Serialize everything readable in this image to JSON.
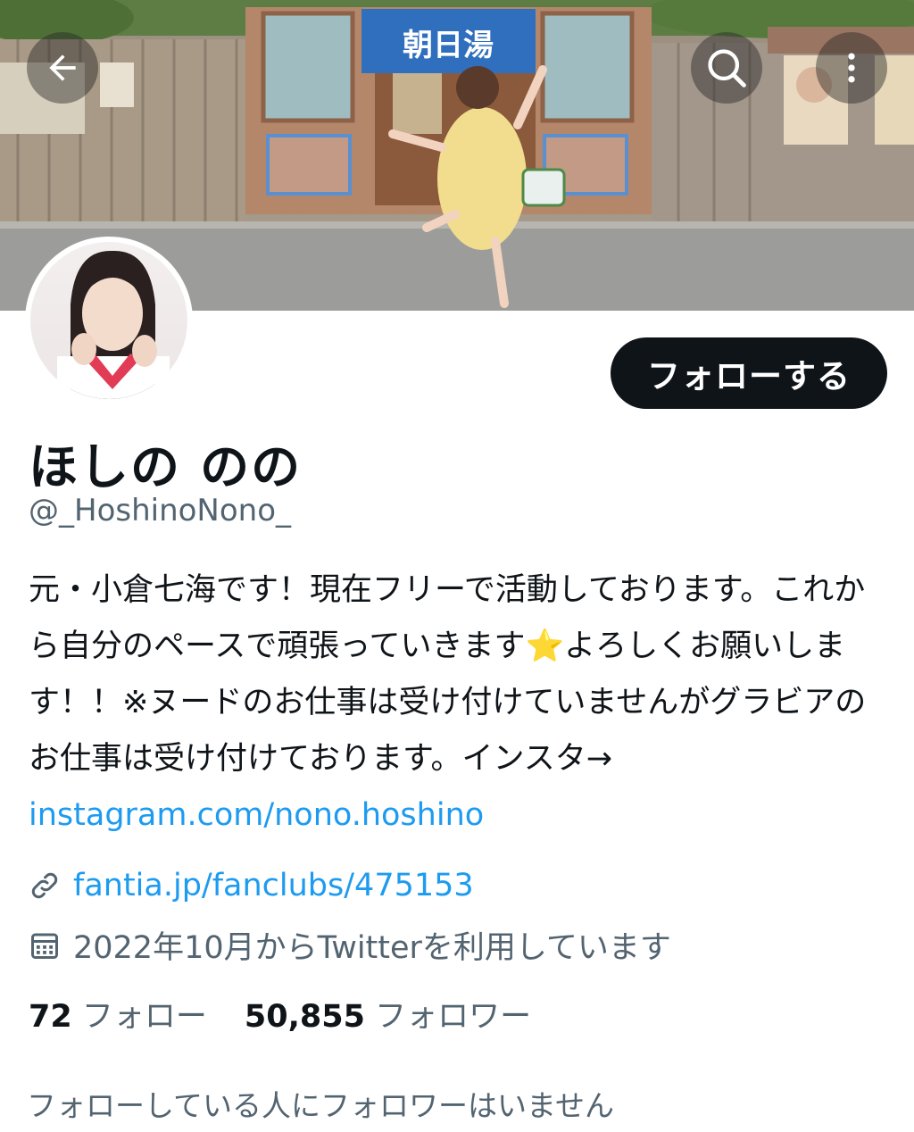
{
  "header": {
    "back_icon": "arrow-left-icon",
    "search_icon": "search-icon",
    "more_icon": "more-vertical-icon",
    "banner_sign": "朝日湯"
  },
  "profile": {
    "follow_label": "フォローする",
    "display_name": "ほしの のの",
    "handle": "@_HoshinoNono_",
    "bio_text": "元・小倉七海です！現在フリーで活動しております。これから自分のペースで頑張っていきます",
    "bio_emoji": "⭐",
    "bio_text_2": "よろしくお願いします！！※ヌードのお仕事は受け付けていませんがグラビアのお仕事は受け付けております。インスタ→ ",
    "bio_link": "instagram.com/nono.hoshino",
    "website": "fantia.jp/fanclubs/475153",
    "joined": "2022年10月からTwitterを利用しています"
  },
  "stats": {
    "following_count": "72",
    "following_label": "フォロー",
    "followers_count": "50,855",
    "followers_label": "フォロワー"
  },
  "followers_you_know": "フォローしている人にフォロワーはいません"
}
